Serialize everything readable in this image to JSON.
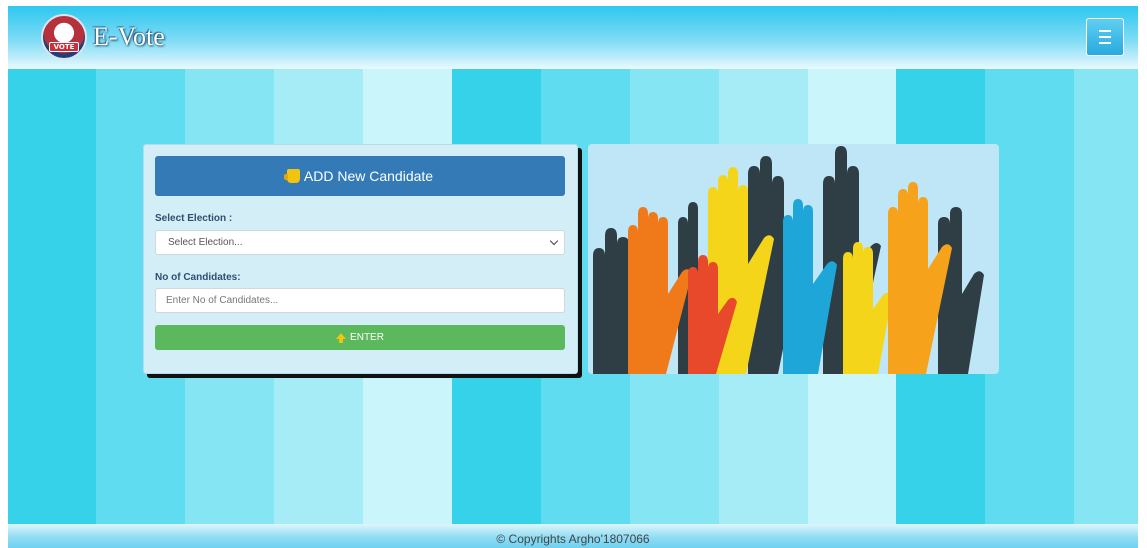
{
  "app": {
    "brand": "E-Vote",
    "logo_text": "VOTE"
  },
  "form": {
    "header": "ADD New Candidate",
    "election_label": "Select Election :",
    "election_selected": "Select Election...",
    "candidates_label": "No of Candidates:",
    "candidates_placeholder": "Enter No of Candidates...",
    "enter_label": "ENTER"
  },
  "footer": {
    "copyright": "© Copyrights Argho'1807066"
  },
  "colors": {
    "header_blue": "#337ab7",
    "enter_green": "#5cb85c"
  },
  "icons": [
    "vote-logo-icon",
    "menu-icon",
    "candidate-hand-icon",
    "chevron-down-icon",
    "upload-icon"
  ]
}
